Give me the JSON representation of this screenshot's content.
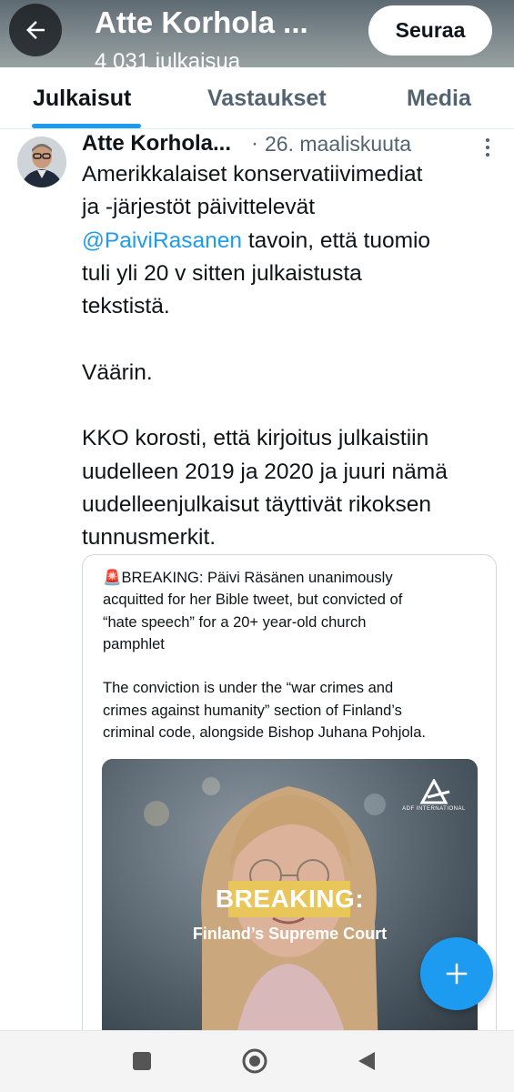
{
  "header": {
    "title": "Atte Korhola ...",
    "subtitle": "4 031 julkaisua",
    "follow_label": "Seuraa",
    "back_icon": "arrow-left-icon"
  },
  "tabs": [
    {
      "label": "Julkaisut",
      "active": true
    },
    {
      "label": "Vastaukset",
      "active": false
    },
    {
      "label": "Media",
      "active": false
    }
  ],
  "post": {
    "author": "Atte Korhola...",
    "separator": "·",
    "date": "26. maaliskuuta",
    "lines": {
      "l1": "Amerikkalaiset konservatiivimediat",
      "l2": "ja -järjestöt päivittelevät",
      "l3_mention": "@PaiviRasanen",
      "l3_rest": " tavoin, että tuomio",
      "l4": "tuli yli 20 v sitten julkaistusta",
      "l5": "tekstistä.",
      "l6": "Väärin.",
      "l7": "KKO korosti, että kirjoitus julkaistiin",
      "l8": "uudelleen 2019 ja 2020 ja juuri nämä",
      "l9": "uudelleenjulkaisut täyttivät rikoksen",
      "l10": "tunnusmerkit."
    }
  },
  "quote": {
    "siren": "🚨",
    "lines": {
      "q1": "BREAKING: Päivi Räsänen unanimously",
      "q2": "acquitted for her Bible tweet, but convicted of",
      "q3": "“hate speech” for a 20+ year-old church",
      "q4": "pamphlet",
      "q5": "The conviction is under the “war crimes and",
      "q6": "crimes against humanity” section of Finland’s",
      "q7": "criminal code, alongside Bishop Juhana Pohjola."
    },
    "image": {
      "logo_text": "ADF INTERNATIONAL",
      "banner": "BREAKING:",
      "caption": "Finland’s Supreme Court"
    }
  },
  "fab_icon": "plus-icon",
  "navbar": {
    "icons": [
      "square-recents-icon",
      "circle-home-icon",
      "triangle-back-icon"
    ]
  },
  "colors": {
    "accent": "#1d9bf0",
    "text": "#0f1419",
    "muted": "#536471",
    "banner": "#e9c65a"
  }
}
